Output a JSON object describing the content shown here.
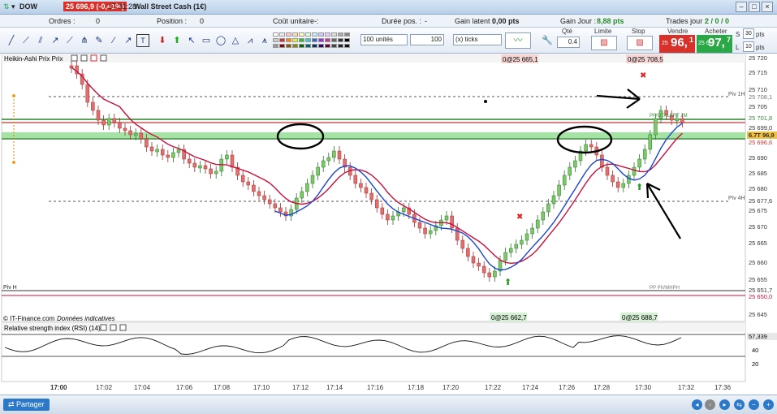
{
  "titlebar": {
    "dow": "DOW",
    "price_change": "25 696,9 (-0,41%)",
    "time": "17:31:28",
    "instrument": "Wall Street Cash (1€)"
  },
  "infobar": {
    "ordres_label": "Ordres :",
    "ordres_value": "0",
    "position_label": "Position :",
    "position_value": "0",
    "cout_label": "Coût unitaire :",
    "cout_value": "-",
    "duree_label": "Durée pos. :",
    "duree_value": "-",
    "latent_label": "Gain latent :",
    "latent_value": "0,00 pts",
    "jour_label": "Gain Jour :",
    "jour_value": "8,88 pts",
    "trades_label": "Trades jour :",
    "trades_value": "2 / 0 / 0"
  },
  "toolbar": {
    "units": "100 unités",
    "qty_ticks": "100",
    "ticks_label": "(x) ticks",
    "qte_label": "Qté",
    "qte_value": "0.4",
    "limite_label": "Limite",
    "stop_label": "Stop",
    "vendre_label": "Vendre",
    "vendre_small": "25 ",
    "vendre_big": "96,",
    "vendre_sup": "1",
    "acheter_label": "Acheter",
    "acheter_small": "25 6",
    "acheter_big": "97,",
    "acheter_sup": "7",
    "s_label": "S",
    "l_label": "L",
    "s_value": "30",
    "l_value": "10",
    "s_unit": "pts",
    "l_unit": "pts"
  },
  "chart": {
    "title": "Heikin-Ashi Prix Prix",
    "credit": "© IT-Finance.com",
    "credit_italic": "Données indicatives",
    "rsi_title": "Relative strength index (RSI) (14)",
    "rsi_value": "57,339",
    "rsi_ticks": [
      "40",
      "20"
    ],
    "order_box_1": "0@25 665,1",
    "order_box_2": "0@25 708,5",
    "order_box_3": "0@25 662,7",
    "order_box_4": "0@25 688,7",
    "piv_1h": "Piv 1H",
    "piv_4h": "Piv 4H",
    "piv_h": "Piv H",
    "pp_text": "PP PIVMHPH",
    "pivotalert": "PIVOTALERT 2M",
    "price_labels": {
      "p25720": "25 720",
      "p25715": "25 715",
      "p25710": "25 710",
      "p25708": "25 708,1",
      "p25705": "25 705",
      "p25701": "25 701,8",
      "p25699": "25 699,0",
      "p25697": "6.7T 96,9",
      "p25696": "25 696,6",
      "p25690": "25 690",
      "p25685": "25 685",
      "p25680": "25 680",
      "p25677": "25 677,6",
      "p25675": "25 675",
      "p25670": "25 670",
      "p25665": "25 665",
      "p25660": "25 660",
      "p25655": "25 655",
      "p25651": "25 651,7",
      "p25650": "25 650,0",
      "p25645": "25 645"
    },
    "time_labels": [
      "17:00",
      "17:02",
      "17:04",
      "17:06",
      "17:08",
      "17:10",
      "17:12",
      "17:14",
      "17:16",
      "17:18",
      "17:20",
      "17:22",
      "17:24",
      "17:26",
      "17:28",
      "17:30",
      "17:32",
      "17:36"
    ]
  },
  "statusbar": {
    "share": "Partager"
  },
  "colors": {
    "up": "#7ec86a",
    "down": "#e07070",
    "ma_red": "#c8103c",
    "ma_blue": "#1a44d0"
  }
}
